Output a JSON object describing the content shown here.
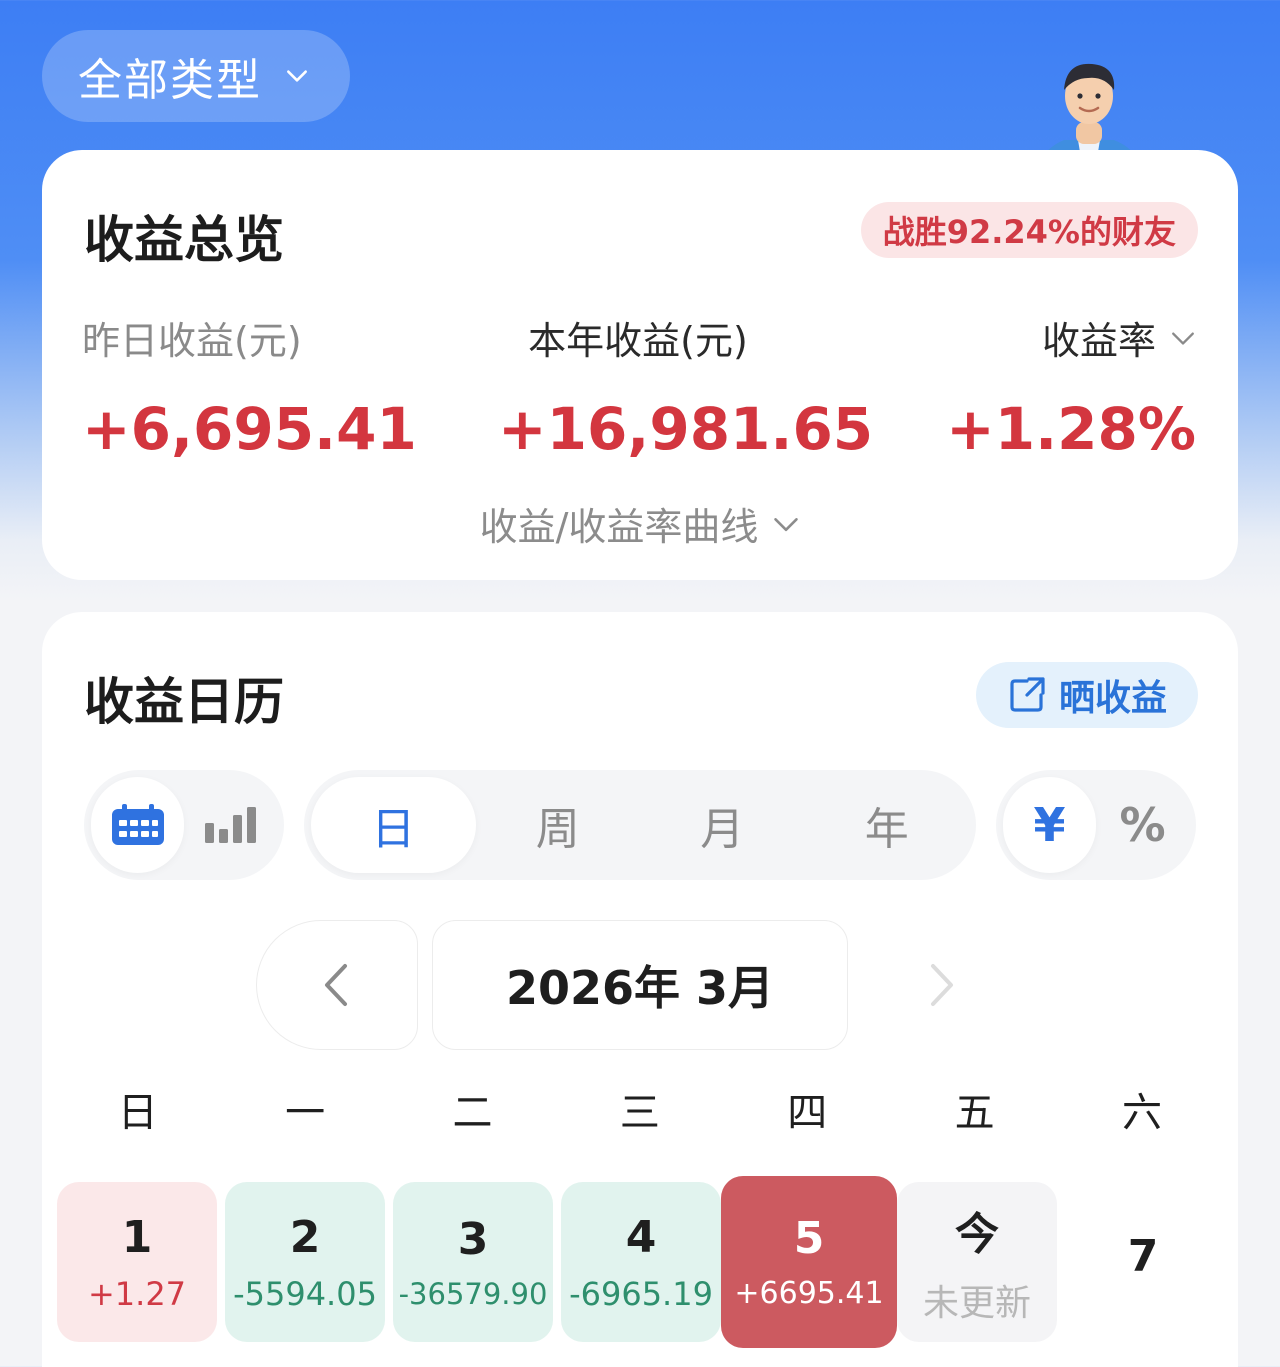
{
  "type_filter": {
    "label": "全部类型"
  },
  "overview": {
    "title": "收益总览",
    "beat_badge": "战胜92.24%的财友",
    "stats": [
      {
        "label": "昨日收益(元)",
        "value": "+6,695.41"
      },
      {
        "label": "本年收益(元)",
        "value": "+16,981.65"
      },
      {
        "label": "收益率",
        "value": "+1.28%"
      }
    ],
    "curve_toggle": "收益/收益率曲线"
  },
  "calendar": {
    "title": "收益日历",
    "share_label": "晒收益",
    "view_modes": [
      {
        "icon": "calendar-icon",
        "active": true
      },
      {
        "icon": "bar-chart-icon",
        "active": false
      }
    ],
    "periods": [
      {
        "label": "日",
        "active": true
      },
      {
        "label": "周",
        "active": false
      },
      {
        "label": "月",
        "active": false
      },
      {
        "label": "年",
        "active": false
      }
    ],
    "units": [
      {
        "label": "¥",
        "active": true
      },
      {
        "label": "%",
        "active": false
      }
    ],
    "month_label": "2026年 3月",
    "weekdays": [
      "日",
      "一",
      "二",
      "三",
      "四",
      "五",
      "六"
    ],
    "days": [
      {
        "num": "1",
        "amount": "+1.27",
        "state": "up"
      },
      {
        "num": "2",
        "amount": "-5594.05",
        "state": "down"
      },
      {
        "num": "3",
        "amount": "-36579.90",
        "state": "down"
      },
      {
        "num": "4",
        "amount": "-6965.19",
        "state": "down"
      },
      {
        "num": "5",
        "amount": "+6695.41",
        "state": "selected"
      },
      {
        "num": "今",
        "amount": "未更新",
        "state": "none"
      },
      {
        "num": "7",
        "amount": "",
        "state": "plain"
      }
    ]
  },
  "colors": {
    "accent_blue": "#2f72e0",
    "gain_red": "#d3363f",
    "loss_green": "#2e8f6d",
    "selected_day": "#cc5a60"
  }
}
